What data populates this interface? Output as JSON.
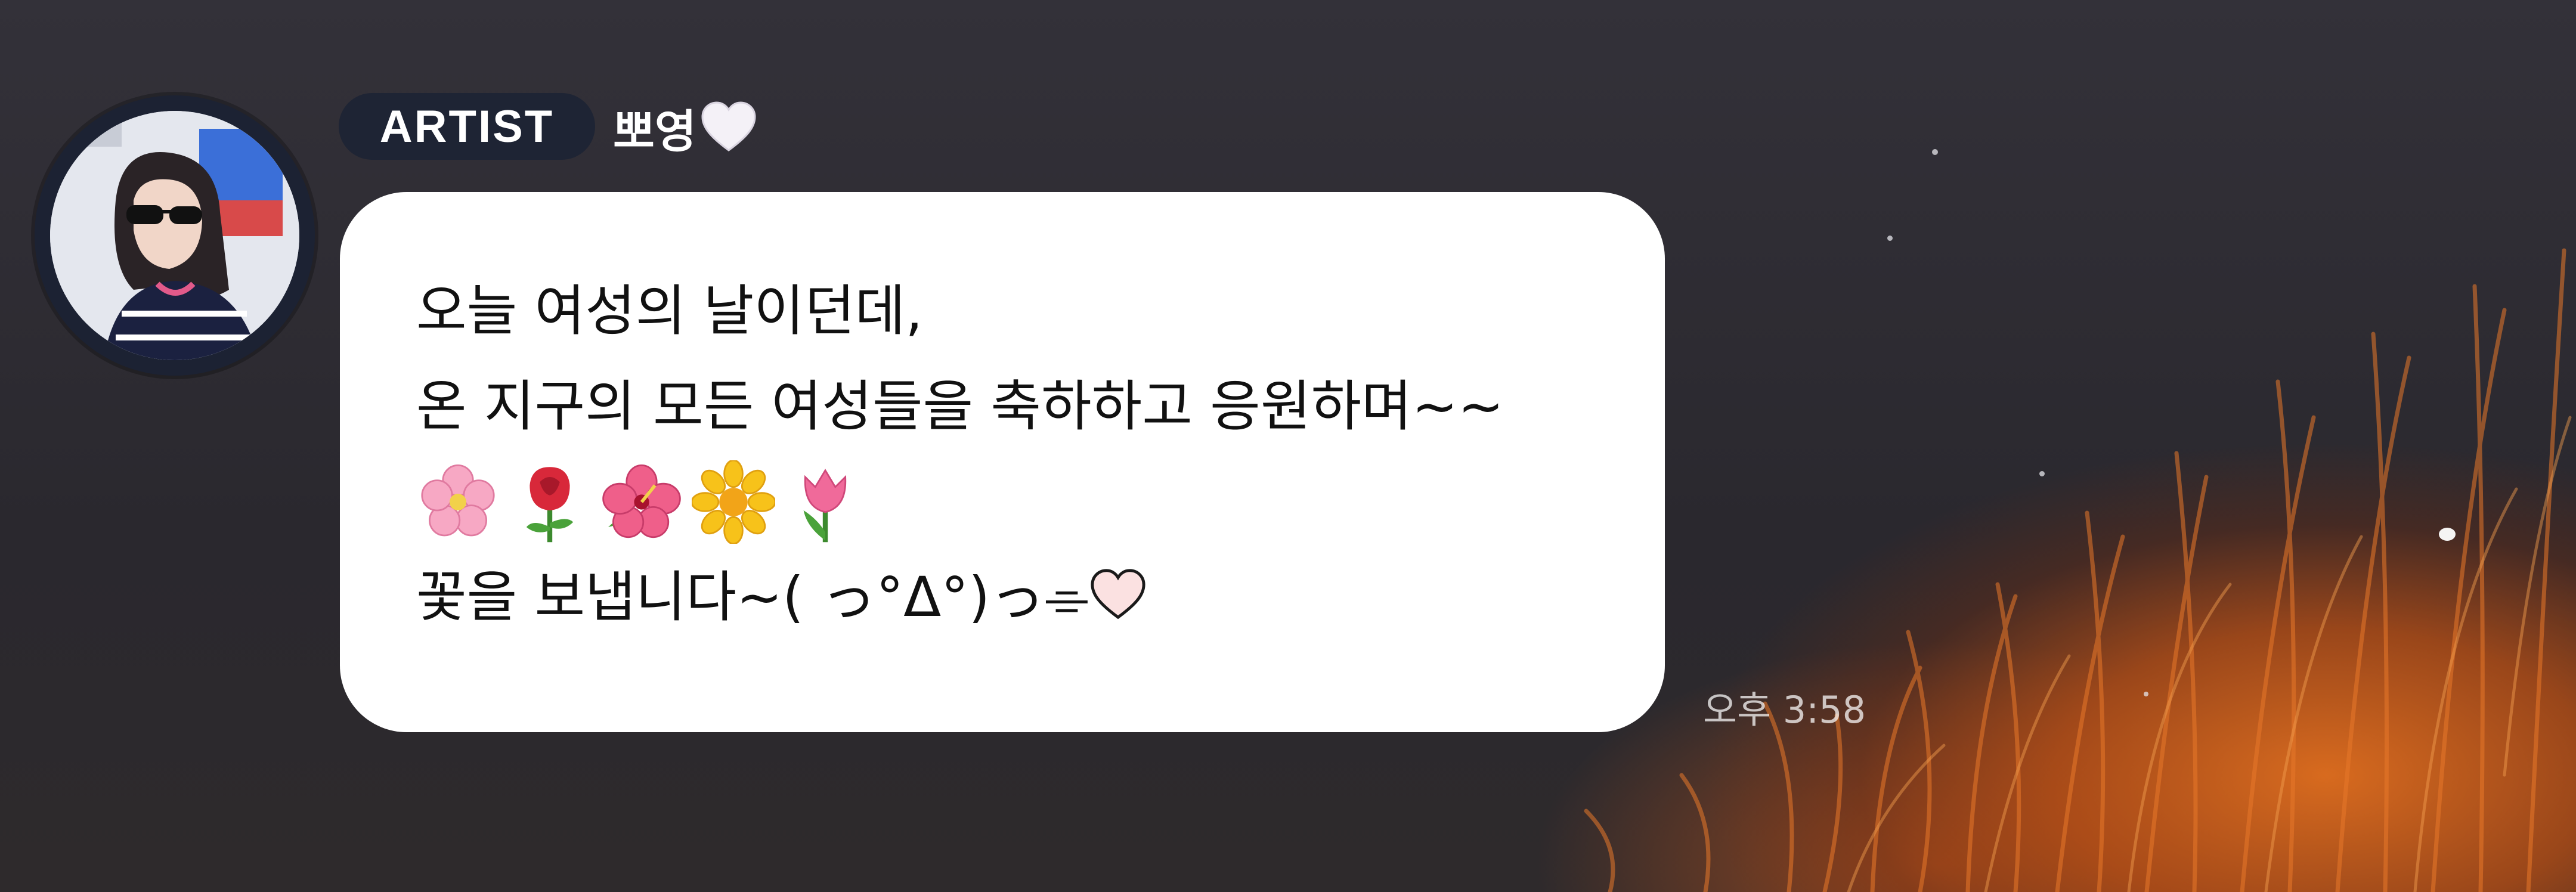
{
  "chat": {
    "badge_label": "ARTIST",
    "artist_name": "뽀영",
    "message_lines": [
      "오늘 여성의 날이던데,",
      "온 지구의 모든 여성들을 축하하고 응원하며~~",
      "꽃을 보냅니다~( っ°ᐃ°)っ⌯"
    ],
    "flower_icons": [
      "cherry-blossom-icon",
      "rose-icon",
      "hibiscus-icon",
      "sunflower-icon",
      "tulip-icon"
    ],
    "timestamp": "오후 3:58"
  },
  "colors": {
    "badge_background": "#1e2434",
    "bubble_background": "#ffffff",
    "background": "#2c2a30",
    "accent_orange": "#e06a1e"
  }
}
